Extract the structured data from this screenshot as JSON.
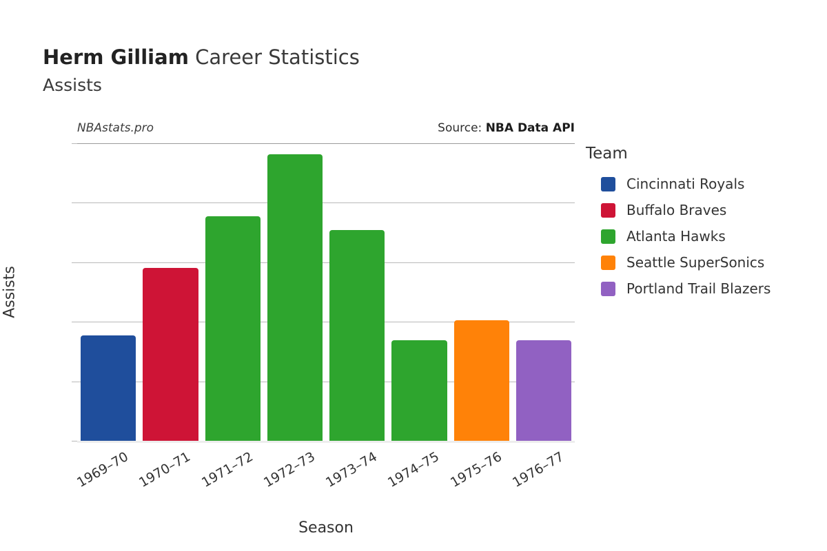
{
  "header": {
    "name": "Herm Gilliam",
    "title_rest": " Career Statistics",
    "subtitle": "Assists"
  },
  "caption": {
    "watermark": "NBAstats.pro",
    "source_label": "Source:",
    "source_value": "NBA Data API"
  },
  "legend": {
    "title": "Team",
    "items": [
      {
        "label": "Cincinnati Royals",
        "color": "#1f4e9c"
      },
      {
        "label": "Buffalo Braves",
        "color": "#ce1436"
      },
      {
        "label": "Atlanta Hawks",
        "color": "#2ea52e"
      },
      {
        "label": "Seattle SuperSonics",
        "color": "#ff8208"
      },
      {
        "label": "Portland Trail Blazers",
        "color": "#9161c2"
      }
    ]
  },
  "chart_data": {
    "type": "bar",
    "title": "Herm Gilliam Career Statistics",
    "subtitle": "Assists",
    "xlabel": "Season",
    "ylabel": "Assists",
    "ylim": [
      0,
      500
    ],
    "yticks": [
      0,
      100,
      200,
      300,
      400,
      500
    ],
    "grid": true,
    "legend_position": "right",
    "categories": [
      "1969–70",
      "1970–71",
      "1971–72",
      "1972–73",
      "1973–74",
      "1974–75",
      "1975–76",
      "1976–77"
    ],
    "values": [
      177,
      290,
      377,
      481,
      354,
      169,
      202,
      169
    ],
    "teams": [
      "Cincinnati Royals",
      "Buffalo Braves",
      "Atlanta Hawks",
      "Atlanta Hawks",
      "Atlanta Hawks",
      "Atlanta Hawks",
      "Seattle SuperSonics",
      "Portland Trail Blazers"
    ],
    "colors": [
      "#1f4e9c",
      "#ce1436",
      "#2ea52e",
      "#2ea52e",
      "#2ea52e",
      "#2ea52e",
      "#ff8208",
      "#9161c2"
    ]
  }
}
